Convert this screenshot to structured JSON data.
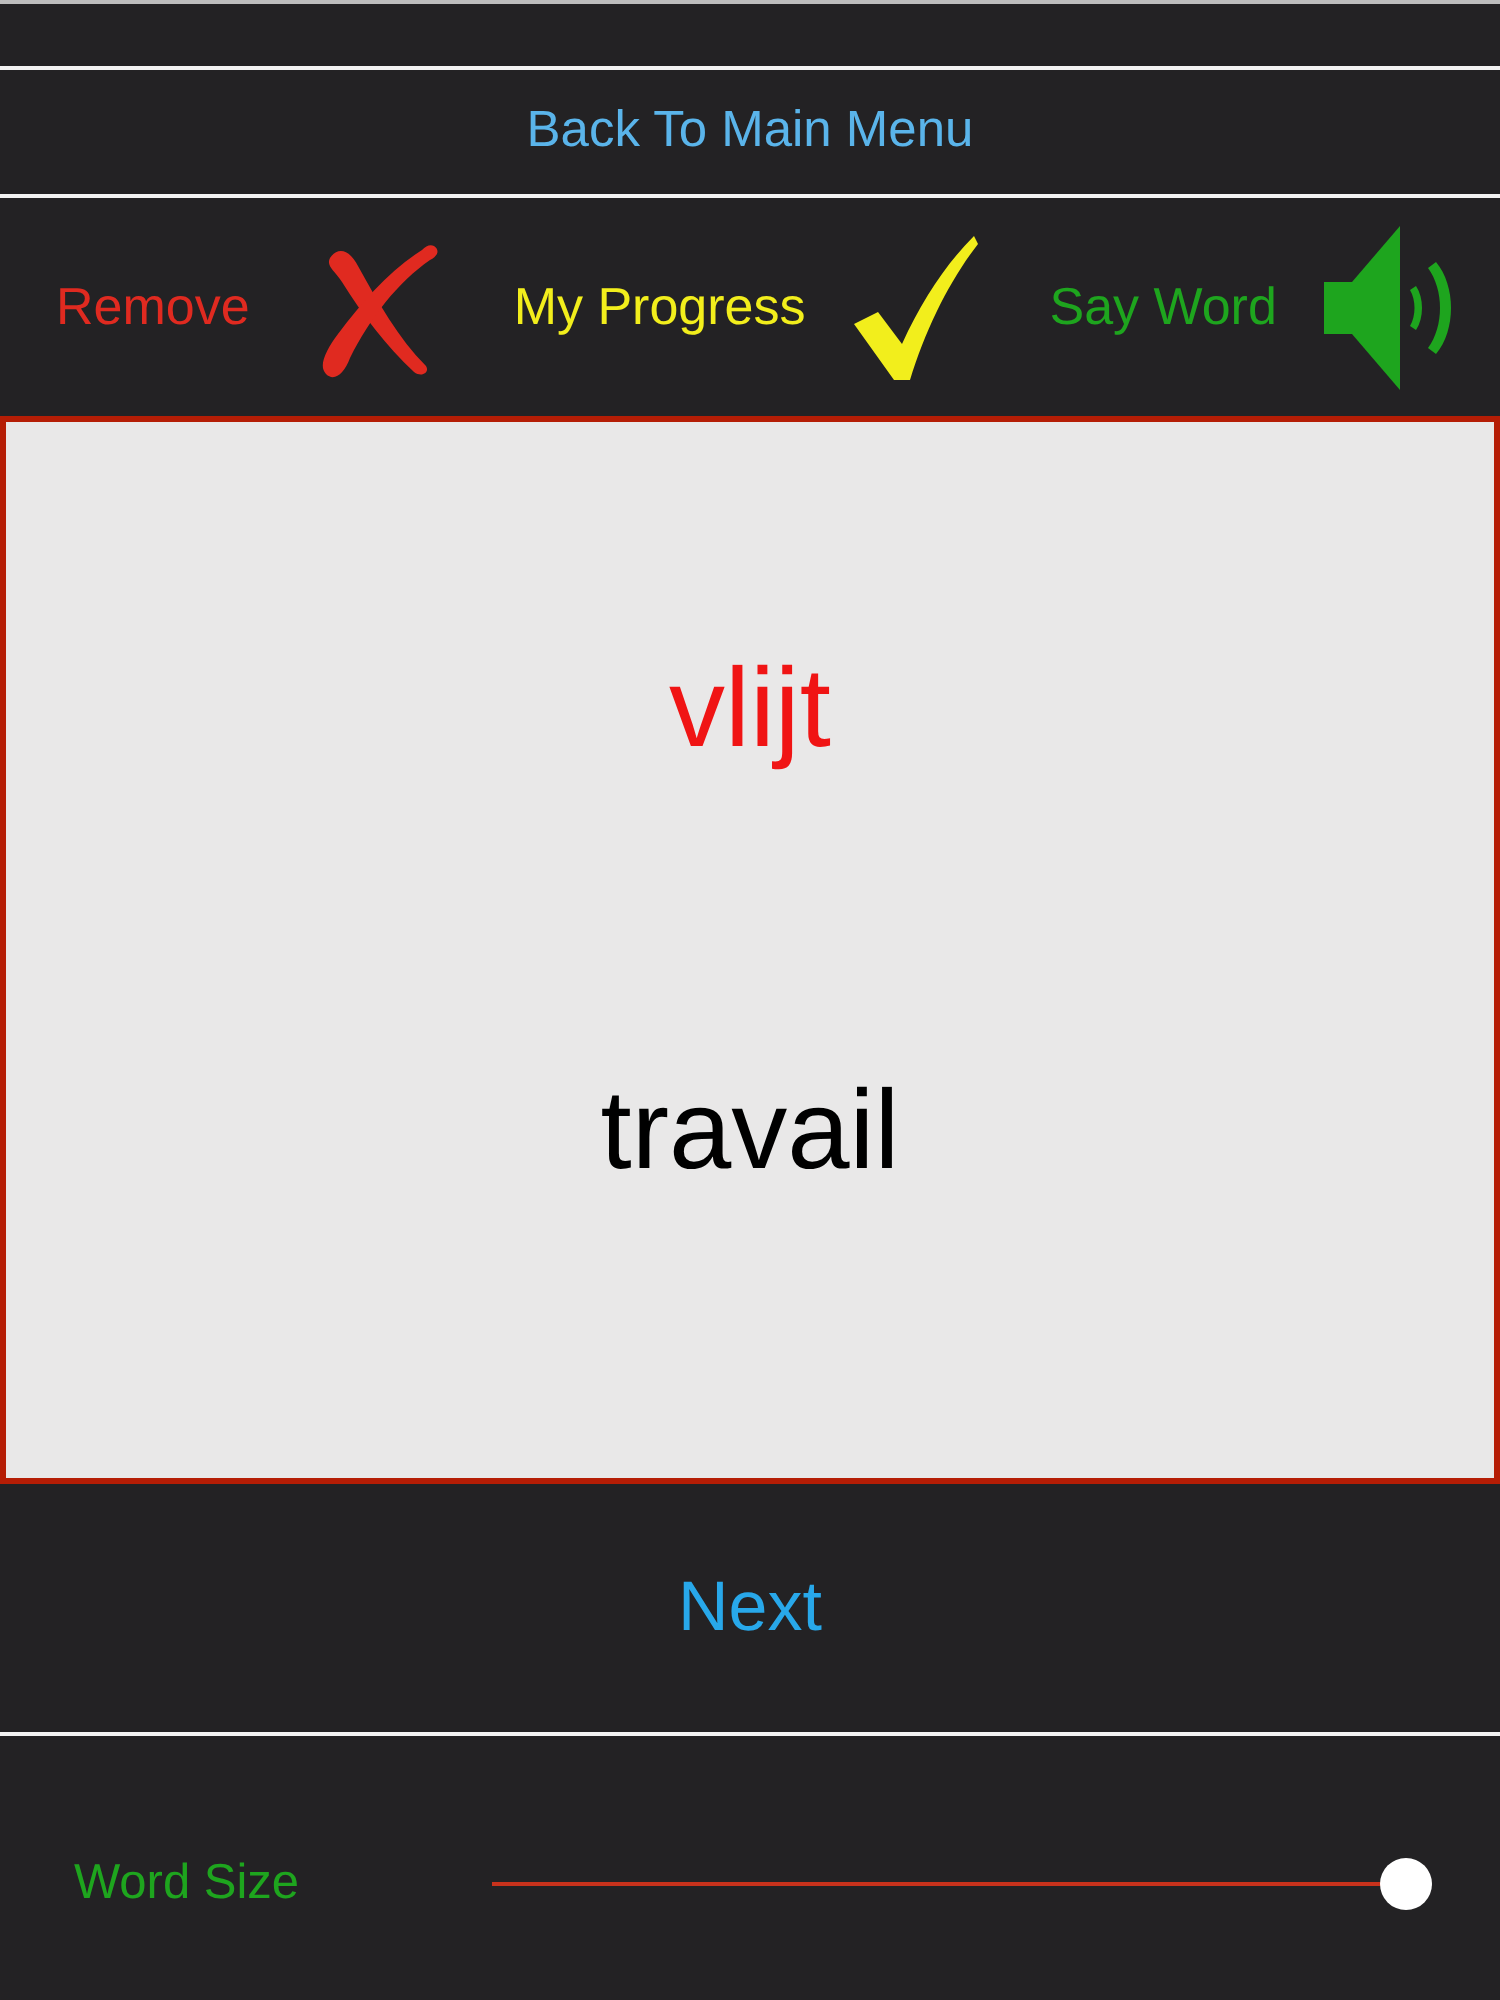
{
  "back_button": {
    "label": "Back To Main Menu"
  },
  "actions": [
    {
      "kind": "remove",
      "label": "Remove",
      "color": "#e02a20"
    },
    {
      "kind": "progress",
      "label": "My Progress",
      "color": "#f2ee1c"
    },
    {
      "kind": "speak",
      "label": "Say Word",
      "color": "#1ea51e"
    }
  ],
  "card": {
    "word": "vlijt",
    "translation": "travail"
  },
  "next_button": {
    "label": "Next"
  },
  "word_size": {
    "label": "Word Size",
    "level": 1
  }
}
